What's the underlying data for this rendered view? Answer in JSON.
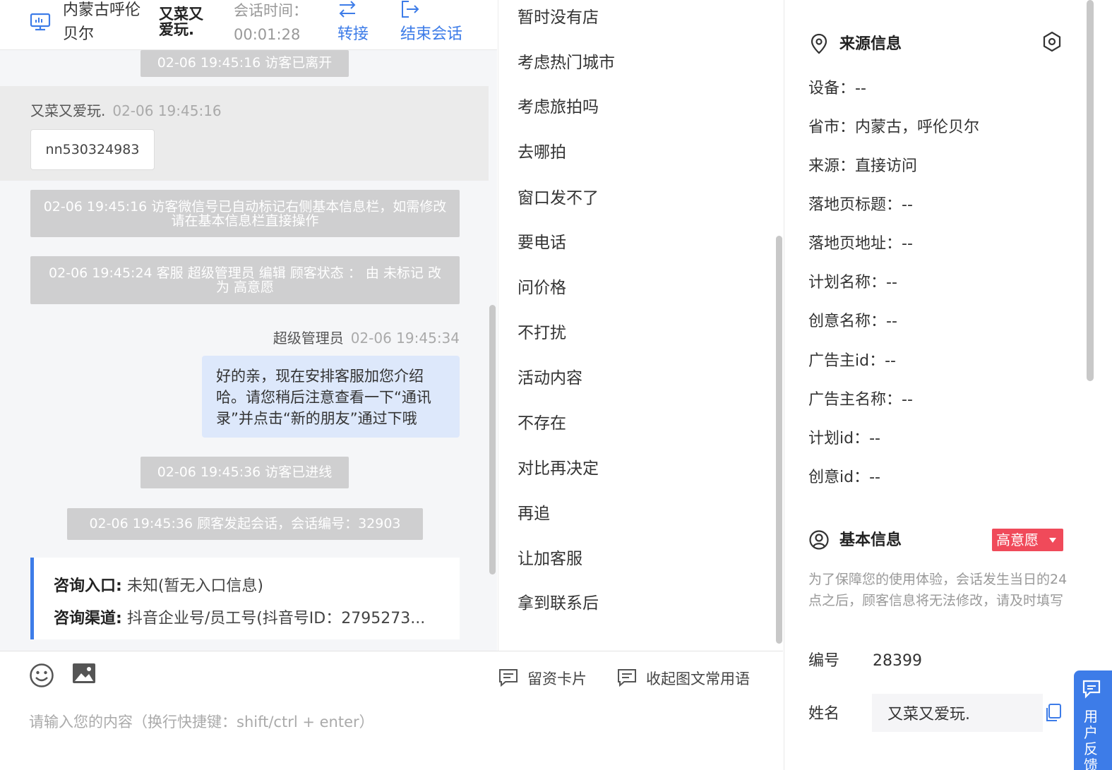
{
  "header": {
    "location": "内蒙古呼伦贝尔",
    "visitor_name": "又菜又爱玩.",
    "session_time_label": "会话时间：",
    "session_time_value": "00:01:28",
    "transfer_label": "转接",
    "end_session_label": "结束会话"
  },
  "chat": {
    "sys_left": "02-06 19:45:16 访客已离开",
    "visitor_name": "又菜又爱玩.",
    "visitor_time": "02-06 19:45:16",
    "visitor_message": "nn530324983",
    "sys_wechat": "02-06 19:45:16 访客微信号已自动标记右侧基本信息栏，如需修改请在基本信息栏直接操作",
    "sys_status_change": "02-06 19:45:24 客服 超级管理员 编辑 顾客状态 ： 由 未标记 改为 高意愿",
    "agent_name": "超级管理员",
    "agent_time": "02-06 19:45:34",
    "agent_message": "好的亲，现在安排客服加您介绍哈。请您稍后注意查看一下“通讯录”并点击“新的朋友”通过下哦",
    "sys_entered": "02-06 19:45:36 访客已进线",
    "sys_session_start": "02-06 19:45:36 顾客发起会话，会话编号：32903",
    "entry_label": "咨询入口:",
    "entry_value": "未知(暂无入口信息)",
    "channel_label": "咨询渠道:",
    "channel_value": "抖音企业号/员工号(抖音号ID：2795273..."
  },
  "quick_replies": [
    "暂时没有店",
    "考虑热门城市",
    "考虑旅拍吗",
    "去哪拍",
    "窗口发不了",
    "要电话",
    "问价格",
    "不打扰",
    "活动内容",
    "不存在",
    "对比再决定",
    "再追",
    "让加客服",
    "拿到联系后"
  ],
  "input": {
    "placeholder": "请输入您的内容（换行快捷键：shift/ctrl + enter）",
    "card_label": "留资卡片",
    "collapse_label": "收起图文常用语"
  },
  "source_info": {
    "title": "来源信息",
    "rows": [
      "设备：--",
      "省市：内蒙古，呼伦贝尔",
      "来源：直接访问",
      "落地页标题：--",
      "落地页地址：--",
      "计划名称：--",
      "创意名称：--",
      "广告主id：--",
      "广告主名称：--",
      "计划id：--",
      "创意id：--"
    ]
  },
  "basic_info": {
    "title": "基本信息",
    "status": "高意愿",
    "note": "为了保障您的使用体验，会话发生当日的24点之后，顾客信息将无法修改，请及时填写",
    "id_label": "编号",
    "id_value": "28399",
    "name_label": "姓名",
    "name_value": "又菜又爱玩."
  },
  "feedback_label": "用户反馈",
  "colors": {
    "accent": "#3d7ce8",
    "status": "#f04a5a",
    "agent_bubble": "#dde8fb",
    "system": "#cfcfd0"
  }
}
